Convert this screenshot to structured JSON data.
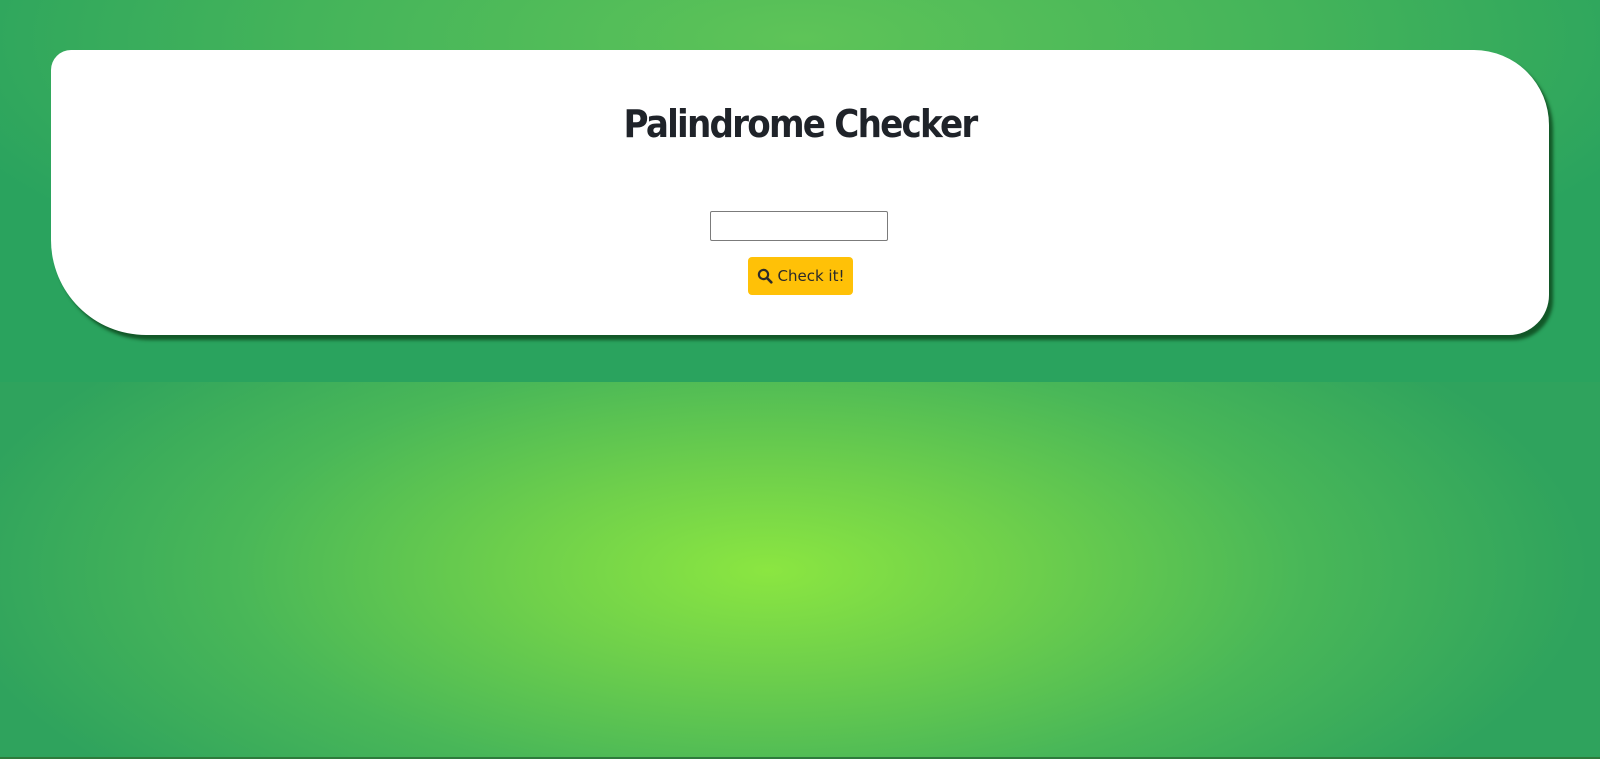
{
  "page": {
    "title": "Palindrome Checker"
  },
  "form": {
    "input_value": "",
    "input_placeholder": "",
    "check_button_label": "Check it!",
    "check_button_icon": "search-icon"
  },
  "colors": {
    "button_accent": "#ffc107",
    "background_green_light": "#8be641",
    "background_green_dark": "#2aa35e",
    "card": "#ffffff",
    "title_text": "#1f2329"
  }
}
